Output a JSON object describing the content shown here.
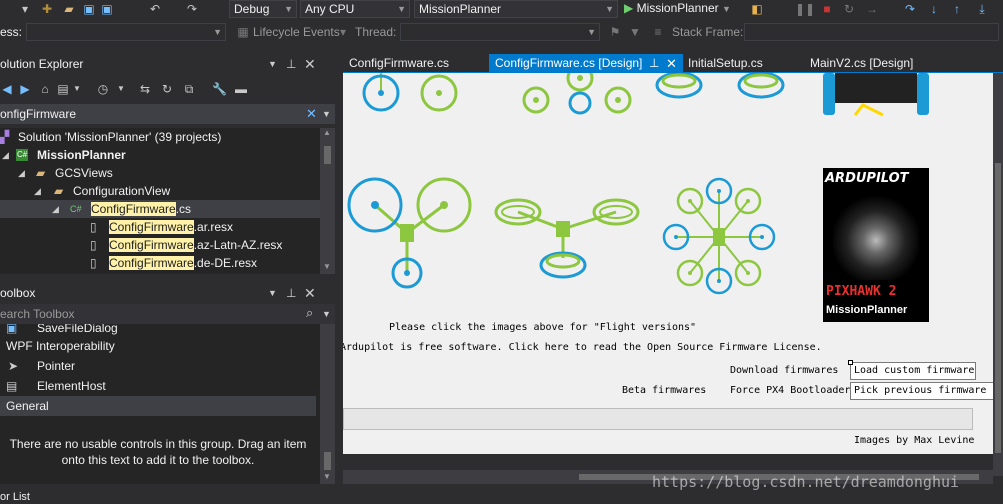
{
  "toolbar": {
    "config": "Debug",
    "platform": "Any CPU",
    "project": "MissionPlanner",
    "start_label": "MissionPlanner"
  },
  "toolbar2": {
    "process_label": "ess:",
    "lifecycle_label": "Lifecycle Events",
    "thread_label": "Thread:",
    "stackframe_label": "Stack Frame:"
  },
  "solution_explorer": {
    "title": "olution Explorer",
    "search_value": "onfigFirmware",
    "items": [
      {
        "label": "Solution 'MissionPlanner' (39 projects)"
      },
      {
        "label": "MissionPlanner"
      },
      {
        "label": "GCSViews"
      },
      {
        "label": "ConfigurationView"
      },
      {
        "prefix": "ConfigFirmware",
        "suffix": ".cs"
      },
      {
        "prefix": "ConfigFirmware",
        "suffix": ".ar.resx"
      },
      {
        "prefix": "ConfigFirmware",
        "suffix": ".az-Latn-AZ.resx"
      },
      {
        "prefix": "ConfigFirmware",
        "suffix": ".de-DE.resx"
      }
    ]
  },
  "toolbox": {
    "title": "oolbox",
    "search_placeholder": "earch Toolbox",
    "items": [
      {
        "label": "SaveFileDialog"
      },
      {
        "label": "WPF Interoperability"
      },
      {
        "label": "Pointer"
      },
      {
        "label": "ElementHost"
      },
      {
        "label": "General"
      }
    ],
    "empty_message_1": "There are no usable controls in this group. Drag an item",
    "empty_message_2": "onto this text to add it to the toolbox."
  },
  "tabs": [
    {
      "label": "ConfigFirmware.cs"
    },
    {
      "label": "ConfigFirmware.cs [Design]"
    },
    {
      "label": "InitialSetup.cs"
    },
    {
      "label": "MainV2.cs [Design]"
    }
  ],
  "design": {
    "flight_versions": "Please click the images above for \"Flight versions\"",
    "license": "Ardupilot is free software. Click here to read the Open Source Firmware License.",
    "download_firmwares": "Download firmwares",
    "load_custom": "Load custom firmware",
    "beta_firmwares": "Beta firmwares",
    "force_bootloader": "Force PX4 Bootloader",
    "pick_previous": "Pick previous firmware",
    "images_by": "Images by Max Levine",
    "board_brand": "ARDUPILOT",
    "board_model": "PIXHAWK 2",
    "board_sub": "MissionPlanner"
  },
  "status": {
    "bottom_label": "or List"
  },
  "watermark": "https://blog.csdn.net/dreamdonghui",
  "colors": {
    "accent": "#007acc",
    "highlight": "#fff2a8",
    "prop_green": "#8dc63f",
    "prop_blue": "#1b9ad6"
  }
}
